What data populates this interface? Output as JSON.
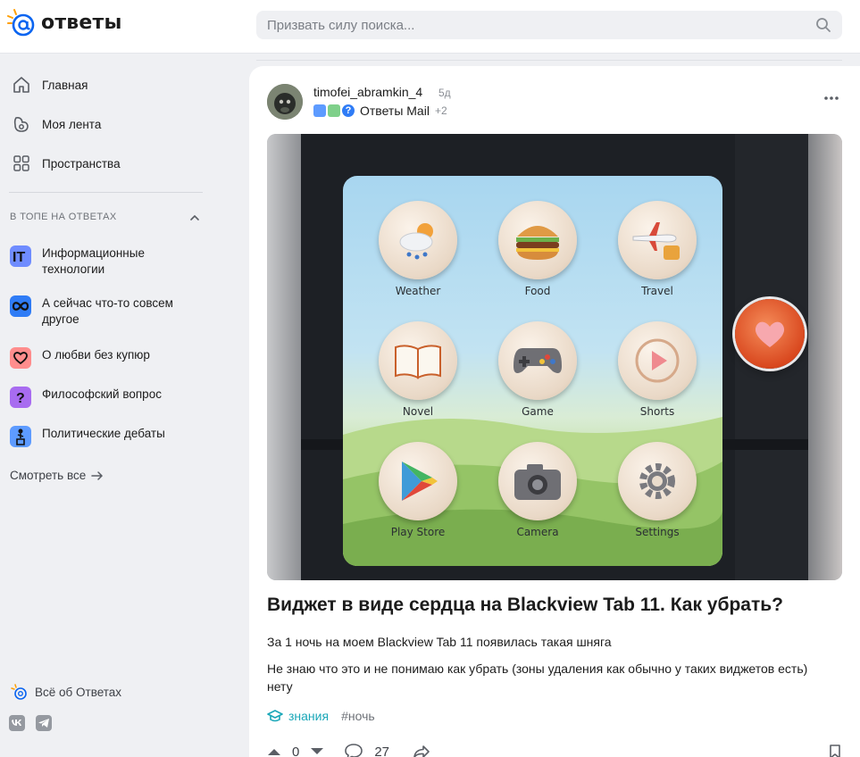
{
  "header": {
    "logo_text": "ответы",
    "search_placeholder": "Призвать силу поиска..."
  },
  "sidebar": {
    "nav": [
      {
        "label": "Главная",
        "icon": "home-icon"
      },
      {
        "label": "Моя лента",
        "icon": "feed-icon"
      },
      {
        "label": "Пространства",
        "icon": "spaces-icon"
      }
    ],
    "section_title": "В ТОПЕ НА ОТВЕТАХ",
    "topics": [
      {
        "label": "Информационные технологии",
        "icon": "it-icon",
        "color": "#6f8cff"
      },
      {
        "label": "А сейчас что-то совсем другое",
        "icon": "infinity-icon",
        "color": "#2f7cf6"
      },
      {
        "label": "О любви без купюр",
        "icon": "heart-icon",
        "color": "#ff8d8d"
      },
      {
        "label": "Философский вопрос",
        "icon": "question-icon",
        "color": "#a86cf0"
      },
      {
        "label": "Политические дебаты",
        "icon": "podium-icon",
        "color": "#5d9bff"
      }
    ],
    "see_all": "Смотреть все",
    "about": "Всё об Ответах"
  },
  "post": {
    "author": "timofei_abramkin_4",
    "age": "5д",
    "space": "Ответы Mail",
    "space_more": "+2",
    "image_apps": [
      "Weather",
      "Food",
      "Travel",
      "Novel",
      "Game",
      "Shorts",
      "Play Store",
      "Camera",
      "Settings"
    ],
    "title": "Виджет в виде сердца на Blackview Tab 11. Как убрать?",
    "paragraph_1": "За 1 ночь на моем Blackview Tab 11 появилась такая шняга",
    "paragraph_2": "Не знаю что это и не понимаю как убрать (зоны удаления как обычно у таких виджетов есть) нету",
    "tag_main": "знания",
    "tag_hash": "#ночь",
    "votes": "0",
    "comments": "27"
  },
  "colors": {
    "accent": "#1aa7b8",
    "logo_blue": "#0a64f0",
    "logo_orange": "#ff9e00",
    "background": "#eff0f3"
  }
}
